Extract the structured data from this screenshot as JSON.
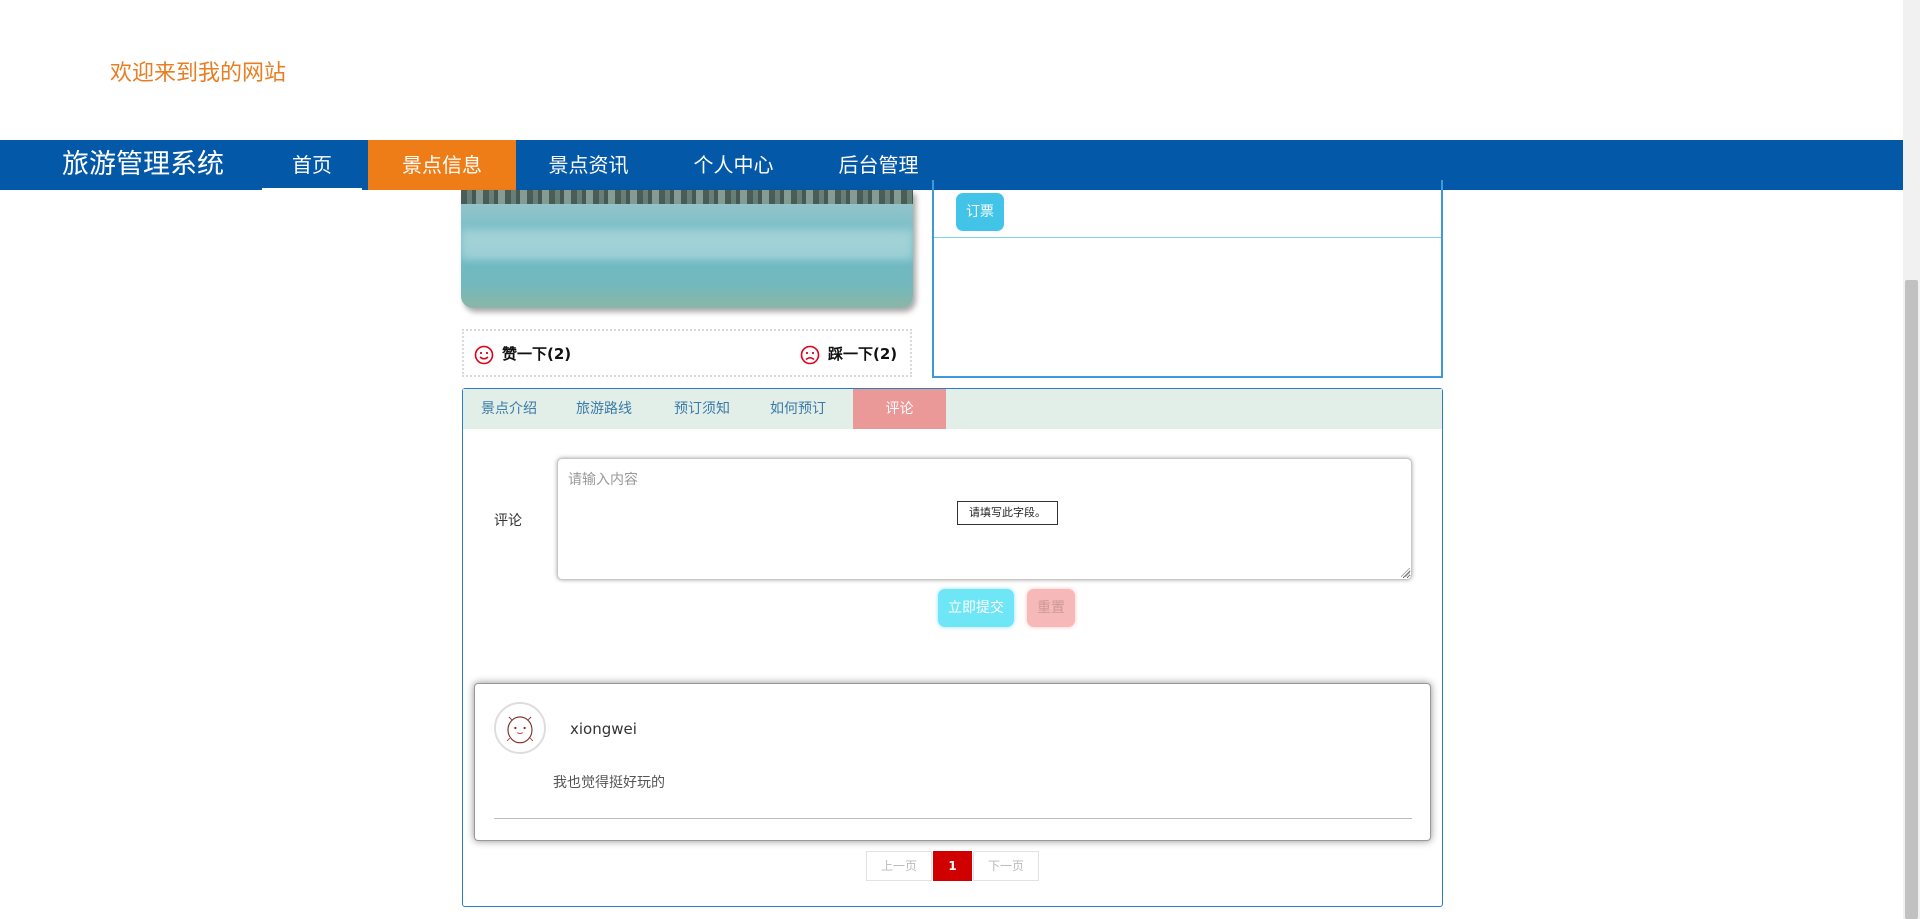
{
  "header": {
    "welcome": "欢迎来到我的网站"
  },
  "nav": {
    "brand": "旅游管理系统",
    "items": [
      "首页",
      "景点信息",
      "景点资讯",
      "个人中心",
      "后台管理"
    ],
    "active_index": 1
  },
  "votes": {
    "like": "赞一下(2)",
    "dislike": "踩一下(2)"
  },
  "info": {
    "order_label": "订票"
  },
  "tabs": {
    "items": [
      "景点介绍",
      "旅游路线",
      "预订须知",
      "如何预订",
      "评论"
    ],
    "active_index": 4
  },
  "comment_form": {
    "label": "评论",
    "placeholder": "请输入内容",
    "validation_tooltip": "请填写此字段。",
    "submit_label": "立即提交",
    "reset_label": "重置"
  },
  "comments": [
    {
      "username": "xiongwei",
      "text": "我也觉得挺好玩的"
    }
  ],
  "pagination": {
    "prev": "上一页",
    "current": "1",
    "next": "下一页"
  },
  "colors": {
    "navbar": "#0458a8",
    "nav_active": "#ee7d18",
    "welcome_text": "#e87e22",
    "tab_active": "#eb9898",
    "submit": "#6fe6f6",
    "page_current": "#d10000"
  }
}
